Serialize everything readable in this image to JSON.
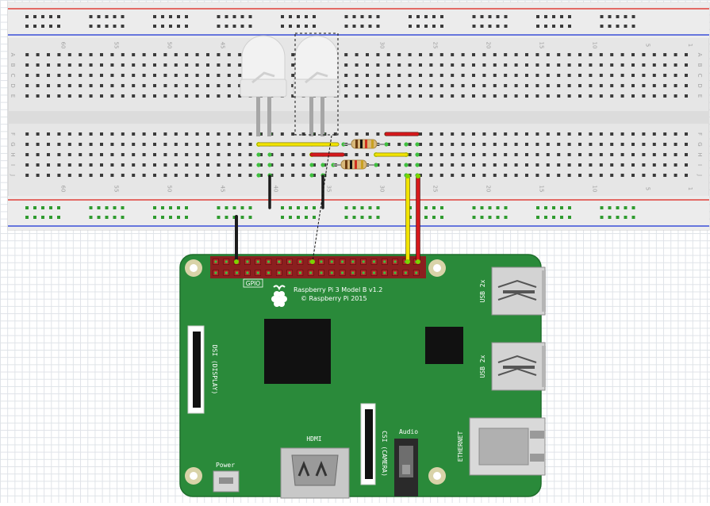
{
  "breadboard": {
    "column_numbers": [
      "60",
      "55",
      "50",
      "45",
      "40",
      "35",
      "30",
      "25",
      "20",
      "15",
      "10",
      "5",
      "1"
    ],
    "row_letters_top": [
      "A",
      "B",
      "C",
      "D",
      "E"
    ],
    "row_letters_bottom": [
      "F",
      "G",
      "H",
      "I",
      "J"
    ]
  },
  "pi": {
    "model_line": "Raspberry Pi 3 Model B v1.2",
    "copyright_line": "© Raspberry Pi 2015",
    "gpio_label": "GPIO",
    "dsi_label": "DSI (DISPLAY)",
    "csi_label": "CSI (CAMERA)",
    "hdmi_label": "HDMI",
    "audio_label": "Audio",
    "power_label": "Power",
    "usb_label_1": "USB 2x",
    "usb_label_2": "USB 2x",
    "ethernet_label": "ETHERNET"
  },
  "colors": {
    "board_green": "#2a8a3a",
    "wire_yellow": "#f2e400",
    "wire_red": "#d7191c",
    "wire_black": "#1c1c1c",
    "rail_red": "#e0403a",
    "rail_blue": "#3a4fd8"
  }
}
